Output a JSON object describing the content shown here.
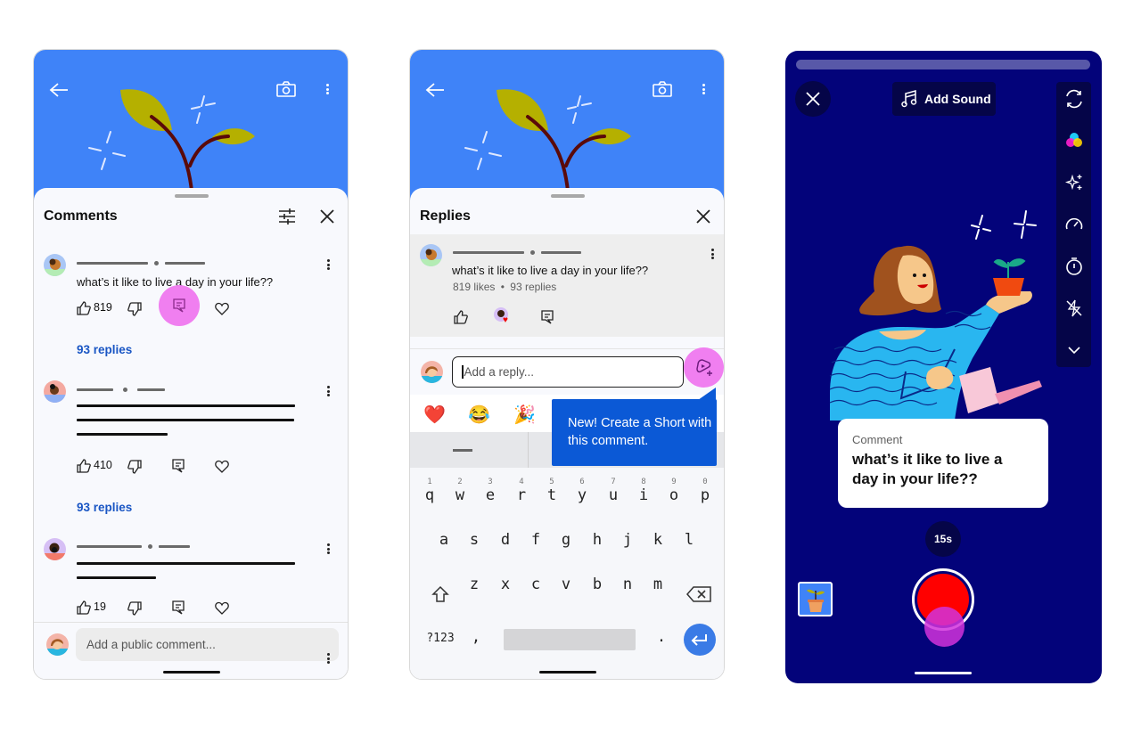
{
  "panel_comments": {
    "title": "Comments",
    "header_icons": [
      "back-arrow-icon",
      "camera-icon",
      "more-vert-icon"
    ],
    "comments": [
      {
        "text": "what’s it like to live a day in your life??",
        "likes": "819",
        "replies_label": "93 replies"
      },
      {
        "text": "",
        "likes": "410",
        "replies_label": "93 replies"
      },
      {
        "text": "",
        "likes": "19",
        "replies_label": ""
      }
    ],
    "input_placeholder": "Add a public comment..."
  },
  "panel_replies": {
    "title": "Replies",
    "parent_comment": {
      "text": "what’s it like to live a day in your life??",
      "likes_label": "819 likes",
      "separator": "•",
      "replies_label": "93 replies"
    },
    "reply_placeholder": "Add a reply...",
    "emojis": [
      "❤️",
      "😂",
      "🎉"
    ],
    "tooltip": "New! Create a Short with this comment.",
    "keyboard": {
      "numbers": [
        "1",
        "2",
        "3",
        "4",
        "5",
        "6",
        "7",
        "8",
        "9",
        "0"
      ],
      "row1": [
        "q",
        "w",
        "e",
        "r",
        "t",
        "y",
        "u",
        "i",
        "o",
        "p"
      ],
      "row2": [
        "a",
        "s",
        "d",
        "f",
        "g",
        "h",
        "j",
        "k",
        "l"
      ],
      "row3": [
        "z",
        "x",
        "c",
        "v",
        "b",
        "n",
        "m"
      ],
      "symbols_key": "?123",
      "comma": ",",
      "period": "."
    }
  },
  "panel_shorts": {
    "add_sound_label": "Add Sound",
    "tools": [
      "flip-camera-icon",
      "filters-icon",
      "effects-icon",
      "speed-icon",
      "timer-icon",
      "flash-off-icon",
      "chevron-down-icon"
    ],
    "comment_card": {
      "label": "Comment",
      "text": "what’s it like to live a day in your life??"
    },
    "duration": "15s"
  },
  "colors": {
    "hero_blue": "#3f83f8",
    "link_blue": "#1a56c4",
    "tooltip_blue": "#0b59d6",
    "highlight_pink": "#f07ff0",
    "shorts_bg": "#03037a",
    "record_red": "#ff0000"
  }
}
